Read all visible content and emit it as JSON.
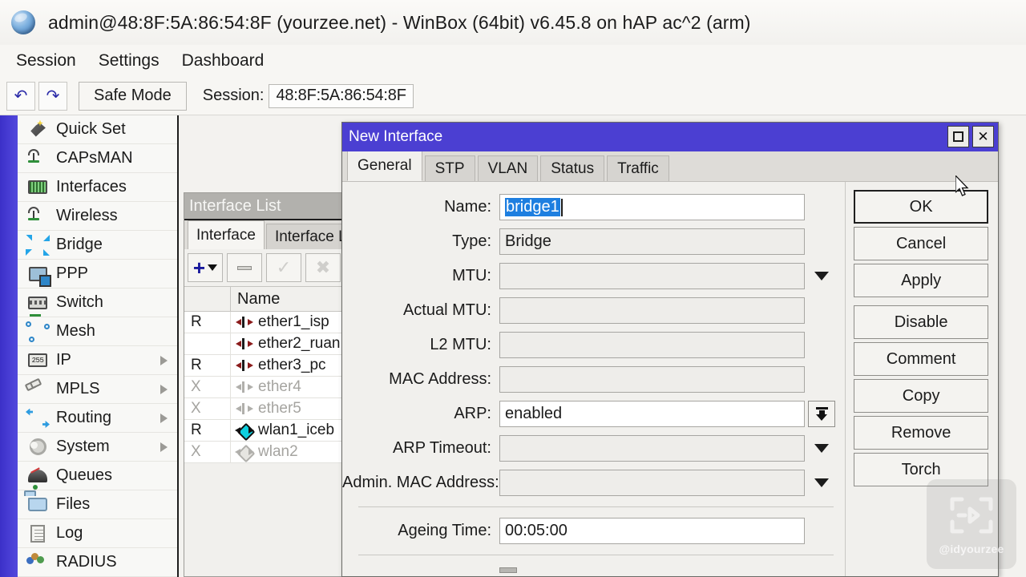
{
  "window": {
    "title": "admin@48:8F:5A:86:54:8F (yourzee.net) - WinBox (64bit) v6.45.8 on hAP ac^2 (arm)",
    "logo_icon": "winbox-globe-icon"
  },
  "menubar": {
    "items": [
      {
        "label": "Session"
      },
      {
        "label": "Settings"
      },
      {
        "label": "Dashboard"
      }
    ]
  },
  "toolbar": {
    "undo_icon": "undo-icon",
    "redo_icon": "redo-icon",
    "safe_mode_label": "Safe Mode",
    "session_label": "Session:",
    "session_value": "48:8F:5A:86:54:8F"
  },
  "sidebar": {
    "items": [
      {
        "label": "Quick Set",
        "icon": "quick-set-icon",
        "has_submenu": false
      },
      {
        "label": "CAPsMAN",
        "icon": "capsman-icon",
        "has_submenu": false
      },
      {
        "label": "Interfaces",
        "icon": "interfaces-icon",
        "has_submenu": false
      },
      {
        "label": "Wireless",
        "icon": "wireless-icon",
        "has_submenu": false
      },
      {
        "label": "Bridge",
        "icon": "bridge-icon",
        "has_submenu": false
      },
      {
        "label": "PPP",
        "icon": "ppp-icon",
        "has_submenu": false
      },
      {
        "label": "Switch",
        "icon": "switch-icon",
        "has_submenu": false
      },
      {
        "label": "Mesh",
        "icon": "mesh-icon",
        "has_submenu": false
      },
      {
        "label": "IP",
        "icon": "ip-icon",
        "has_submenu": true
      },
      {
        "label": "MPLS",
        "icon": "mpls-icon",
        "has_submenu": true
      },
      {
        "label": "Routing",
        "icon": "routing-icon",
        "has_submenu": true
      },
      {
        "label": "System",
        "icon": "system-gear-icon",
        "has_submenu": true
      },
      {
        "label": "Queues",
        "icon": "queues-icon",
        "has_submenu": false
      },
      {
        "label": "Files",
        "icon": "files-folder-icon",
        "has_submenu": false
      },
      {
        "label": "Log",
        "icon": "log-icon",
        "has_submenu": false
      },
      {
        "label": "RADIUS",
        "icon": "radius-icon",
        "has_submenu": false
      }
    ]
  },
  "interface_list": {
    "title": "Interface List",
    "tabs": [
      {
        "label": "Interface",
        "active": true
      },
      {
        "label": "Interface L",
        "active": false
      }
    ],
    "toolbar_buttons": [
      {
        "name": "add-button",
        "icon": "plus-icon",
        "enabled": true
      },
      {
        "name": "remove-button",
        "icon": "minus-icon",
        "enabled": true
      },
      {
        "name": "enable-button",
        "icon": "check-icon",
        "enabled": false
      },
      {
        "name": "disable-button",
        "icon": "cross-icon",
        "enabled": false
      }
    ],
    "columns": [
      "",
      "Name"
    ],
    "rows": [
      {
        "flag": "R",
        "name": "ether1_isp",
        "icon": "ethernet-icon",
        "disabled": false
      },
      {
        "flag": "",
        "name": "ether2_ruan",
        "icon": "ethernet-icon",
        "disabled": false
      },
      {
        "flag": "R",
        "name": "ether3_pc",
        "icon": "ethernet-icon",
        "disabled": false
      },
      {
        "flag": "X",
        "name": "ether4",
        "icon": "ethernet-icon",
        "disabled": true
      },
      {
        "flag": "X",
        "name": "ether5",
        "icon": "ethernet-icon",
        "disabled": true
      },
      {
        "flag": "R",
        "name": "wlan1_iceb",
        "icon": "wireless-interface-icon",
        "disabled": false
      },
      {
        "flag": "X",
        "name": "wlan2",
        "icon": "wireless-interface-icon",
        "disabled": true
      }
    ]
  },
  "dialog": {
    "title": "New Interface",
    "maximize_icon": "maximize-icon",
    "close_icon": "close-icon",
    "tabs": [
      {
        "label": "General",
        "active": true
      },
      {
        "label": "STP",
        "active": false
      },
      {
        "label": "VLAN",
        "active": false
      },
      {
        "label": "Status",
        "active": false
      },
      {
        "label": "Traffic",
        "active": false
      }
    ],
    "fields": [
      {
        "label": "Name:",
        "value": "bridge1",
        "selected": true,
        "editable": true,
        "dropdown": "none"
      },
      {
        "label": "Type:",
        "value": "Bridge",
        "selected": false,
        "editable": false,
        "dropdown": "none"
      },
      {
        "label": "MTU:",
        "value": "",
        "selected": false,
        "editable": true,
        "dropdown": "triangle"
      },
      {
        "label": "Actual MTU:",
        "value": "",
        "selected": false,
        "editable": false,
        "dropdown": "none"
      },
      {
        "label": "L2 MTU:",
        "value": "",
        "selected": false,
        "editable": false,
        "dropdown": "none"
      },
      {
        "label": "MAC Address:",
        "value": "",
        "selected": false,
        "editable": false,
        "dropdown": "none"
      },
      {
        "label": "ARP:",
        "value": "enabled",
        "selected": false,
        "editable": true,
        "dropdown": "boxed"
      },
      {
        "label": "ARP Timeout:",
        "value": "",
        "selected": false,
        "editable": true,
        "dropdown": "triangle"
      },
      {
        "label": "Admin. MAC Address:",
        "value": "",
        "selected": false,
        "editable": true,
        "dropdown": "triangle"
      }
    ],
    "ageing": {
      "label": "Ageing Time:",
      "value": "00:05:00"
    },
    "buttons": [
      {
        "label": "OK",
        "primary": true,
        "gap": false
      },
      {
        "label": "Cancel",
        "primary": false,
        "gap": false
      },
      {
        "label": "Apply",
        "primary": false,
        "gap": false
      },
      {
        "label": "Disable",
        "primary": false,
        "gap": true
      },
      {
        "label": "Comment",
        "primary": false,
        "gap": false
      },
      {
        "label": "Copy",
        "primary": false,
        "gap": false
      },
      {
        "label": "Remove",
        "primary": false,
        "gap": false
      },
      {
        "label": "Torch",
        "primary": false,
        "gap": false
      }
    ]
  },
  "watermark": {
    "handle": "@idyourzee",
    "icon": "channel-logo-icon"
  },
  "colors": {
    "dialog_title_bg": "#4b3fd2",
    "accent_bar": "#4a3fd6",
    "selection_blue": "#1e7fe0",
    "window_bg": "#f1f0ed",
    "list_title_bg": "#b2b1ad"
  }
}
